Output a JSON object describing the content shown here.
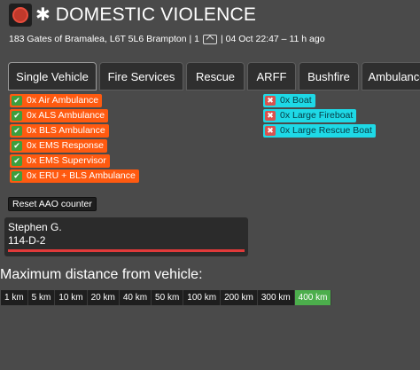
{
  "header": {
    "title": "DOMESTIC VIOLENCE",
    "address": "183 Gates of Bramalea, L6T 5L6 Brampton | 1",
    "time": "| 04 Oct 22:47 – 11 h ago",
    "mission_icon": "mission-marker-icon",
    "star_icon": "star-icon",
    "vehicle_icon": "ambulance-icon"
  },
  "tabs": [
    {
      "label": "Single Vehicle",
      "active": true
    },
    {
      "label": "Fire Services"
    },
    {
      "label": "Rescue"
    },
    {
      "label": "ARFF"
    },
    {
      "label": "Bushfire"
    },
    {
      "label": "Ambulance"
    }
  ],
  "requirements_met": [
    "0x Air Ambulance",
    "0x ALS Ambulance",
    "0x BLS Ambulance",
    "0x EMS Response",
    "0x EMS Supervisor",
    "0x ERU + BLS Ambulance"
  ],
  "requirements_missing": [
    "0x Boat",
    "0x Large Fireboat",
    "0x Large Rescue Boat"
  ],
  "reset_button": "Reset AAO counter",
  "patient": {
    "name": "Stephen G.",
    "code": "114-D-2"
  },
  "distance": {
    "label": "Maximum distance from vehicle:",
    "options": [
      "1 km",
      "5 km",
      "10 km",
      "20 km",
      "40 km",
      "50 km",
      "100 km",
      "200 km",
      "300 km",
      "400 km"
    ],
    "selected": "400 km"
  },
  "colors": {
    "met": "#ff5a10",
    "missing": "#1ed9e6",
    "selected": "#4cae4c",
    "patient_bar": "#e03a3a"
  }
}
